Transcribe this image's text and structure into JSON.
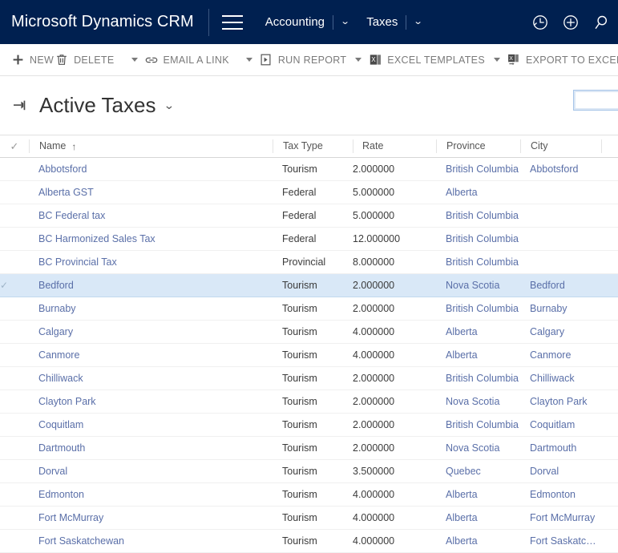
{
  "navbar": {
    "brand": "Microsoft Dynamics CRM",
    "menu_icon": "hamburger-icon",
    "breadcrumbs": [
      {
        "label": "Accounting",
        "caret": "⌄"
      },
      {
        "label": "Taxes",
        "caret": "⌄"
      }
    ],
    "icons": [
      {
        "name": "recent-clock-icon"
      },
      {
        "name": "quick-create-plus-icon"
      },
      {
        "name": "global-search-icon"
      }
    ],
    "background_color": "#002050"
  },
  "commandbar": {
    "items": [
      {
        "label": "NEW",
        "icon": "plus-icon",
        "has_caret": false
      },
      {
        "label": "DELETE",
        "icon": "trash-icon",
        "has_caret": true
      },
      {
        "label": "EMAIL A LINK",
        "icon": "link-icon",
        "has_caret": true
      },
      {
        "label": "RUN REPORT",
        "icon": "report-icon",
        "has_caret": true
      },
      {
        "label": "EXCEL TEMPLATES",
        "icon": "excel-icon",
        "has_caret": true
      },
      {
        "label": "EXPORT TO EXCEL",
        "icon": "export-excel-icon",
        "has_caret": true
      }
    ],
    "overflow_icon": "more-commands-icon"
  },
  "view": {
    "pin_icon": "pin-icon",
    "title": "Active Taxes",
    "title_caret": "⌄"
  },
  "search": {
    "value": "",
    "placeholder": "",
    "focused": true
  },
  "grid": {
    "select_all_glyph": "✓",
    "row_check_glyph": "✓",
    "columns": [
      {
        "key": "name",
        "label": "Name",
        "sort": "↑"
      },
      {
        "key": "tax_type",
        "label": "Tax Type",
        "sort": ""
      },
      {
        "key": "rate",
        "label": "Rate",
        "sort": ""
      },
      {
        "key": "province",
        "label": "Province",
        "sort": ""
      },
      {
        "key": "city",
        "label": "City",
        "sort": ""
      }
    ],
    "rows": [
      {
        "name": "Abbotsford",
        "tax_type": "Tourism",
        "rate": "2.000000",
        "province": "British Columbia",
        "city": "Abbotsford",
        "selected": false
      },
      {
        "name": "Alberta GST",
        "tax_type": "Federal",
        "rate": "5.000000",
        "province": "Alberta",
        "city": "",
        "selected": false
      },
      {
        "name": "BC Federal tax",
        "tax_type": "Federal",
        "rate": "5.000000",
        "province": "British Columbia",
        "city": "",
        "selected": false
      },
      {
        "name": "BC Harmonized Sales Tax",
        "tax_type": "Federal",
        "rate": "12.000000",
        "province": "British Columbia",
        "city": "",
        "selected": false
      },
      {
        "name": "BC Provincial Tax",
        "tax_type": "Provincial",
        "rate": "8.000000",
        "province": "British Columbia",
        "city": "",
        "selected": false
      },
      {
        "name": "Bedford",
        "tax_type": "Tourism",
        "rate": "2.000000",
        "province": "Nova Scotia",
        "city": "Bedford",
        "selected": true
      },
      {
        "name": "Burnaby",
        "tax_type": "Tourism",
        "rate": "2.000000",
        "province": "British Columbia",
        "city": "Burnaby",
        "selected": false
      },
      {
        "name": "Calgary",
        "tax_type": "Tourism",
        "rate": "4.000000",
        "province": "Alberta",
        "city": "Calgary",
        "selected": false
      },
      {
        "name": "Canmore",
        "tax_type": "Tourism",
        "rate": "4.000000",
        "province": "Alberta",
        "city": "Canmore",
        "selected": false
      },
      {
        "name": "Chilliwack",
        "tax_type": "Tourism",
        "rate": "2.000000",
        "province": "British Columbia",
        "city": "Chilliwack",
        "selected": false
      },
      {
        "name": "Clayton Park",
        "tax_type": "Tourism",
        "rate": "2.000000",
        "province": "Nova Scotia",
        "city": "Clayton Park",
        "selected": false
      },
      {
        "name": "Coquitlam",
        "tax_type": "Tourism",
        "rate": "2.000000",
        "province": "British Columbia",
        "city": "Coquitlam",
        "selected": false
      },
      {
        "name": "Dartmouth",
        "tax_type": "Tourism",
        "rate": "2.000000",
        "province": "Nova Scotia",
        "city": "Dartmouth",
        "selected": false
      },
      {
        "name": "Dorval",
        "tax_type": "Tourism",
        "rate": "3.500000",
        "province": "Quebec",
        "city": "Dorval",
        "selected": false
      },
      {
        "name": "Edmonton",
        "tax_type": "Tourism",
        "rate": "4.000000",
        "province": "Alberta",
        "city": "Edmonton",
        "selected": false
      },
      {
        "name": "Fort McMurray",
        "tax_type": "Tourism",
        "rate": "4.000000",
        "province": "Alberta",
        "city": "Fort McMurray",
        "selected": false
      },
      {
        "name": "Fort Saskatchewan",
        "tax_type": "Tourism",
        "rate": "4.000000",
        "province": "Alberta",
        "city": "Fort Saskatchew...",
        "selected": false
      }
    ]
  },
  "colors": {
    "nav_background": "#002050",
    "link": "#5a6fa8",
    "selected_row": "#d9e8f7",
    "text": "#3b3b3b"
  }
}
